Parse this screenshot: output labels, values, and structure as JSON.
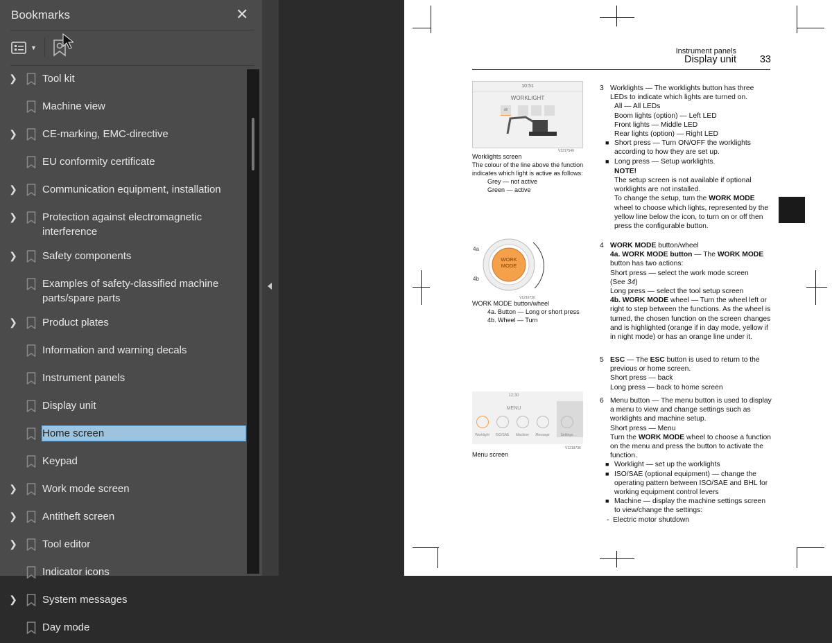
{
  "sidebar": {
    "title": "Bookmarks",
    "close_icon": "close-icon",
    "items": [
      {
        "label": "Tool kit",
        "expandable": true
      },
      {
        "label": "Machine view",
        "expandable": false
      },
      {
        "label": "CE-marking, EMC-directive",
        "expandable": true
      },
      {
        "label": "EU conformity certificate",
        "expandable": false
      },
      {
        "label": "Communication equipment, installation",
        "expandable": true
      },
      {
        "label": "Protection against electromagnetic interference",
        "expandable": true
      },
      {
        "label": "Safety components",
        "expandable": true
      },
      {
        "label": "Examples of safety-classified machine parts/spare parts",
        "expandable": false
      },
      {
        "label": "Product plates",
        "expandable": true
      },
      {
        "label": "Information and warning decals",
        "expandable": false
      },
      {
        "label": "Instrument panels",
        "expandable": false
      },
      {
        "label": "Display unit",
        "expandable": false
      },
      {
        "label": "Home screen",
        "expandable": false,
        "selected": true
      },
      {
        "label": "Keypad",
        "expandable": false
      },
      {
        "label": "Work mode screen",
        "expandable": true
      },
      {
        "label": "Antitheft screen",
        "expandable": true
      },
      {
        "label": "Tool editor",
        "expandable": true
      },
      {
        "label": "Indicator icons",
        "expandable": false
      },
      {
        "label": "System messages",
        "expandable": true
      },
      {
        "label": "Day mode",
        "expandable": false
      }
    ]
  },
  "page": {
    "section": "Instrument panels",
    "title": "Display unit",
    "number": "33",
    "fig1": {
      "screen_time": "10:51",
      "screen_title": "WORKLIGHT",
      "screen_btn": "All",
      "code": "V1217549",
      "caption": "Worklights screen",
      "desc": "The colour of the line above the function indicates which light is active as follows:",
      "lines": [
        "Grey — not active",
        "Green — active"
      ]
    },
    "fig2": {
      "label_a": "4a",
      "label_b": "4b",
      "knob": "WORK MODE",
      "code": "V1216736",
      "caption": "WORK MODE button/wheel",
      "lines": [
        "4a. Button — Long or short press",
        "4b. Wheel — Turn"
      ]
    },
    "fig3": {
      "screen_time": "12:30",
      "screen_title": "MENU",
      "menu": [
        "Worklight",
        "ISO/SAE",
        "Machine",
        "Message",
        "Settings"
      ],
      "code": "V1219736",
      "caption": "Menu screen"
    },
    "item3": {
      "num": "3",
      "intro": "Worklights — The worklights button has three LEDs to indicate which lights are turned on.",
      "sub": [
        "All — All LEDs",
        "Boom lights (option) — Left LED",
        "Front lights — Middle LED",
        "Rear lights (option) — Right LED"
      ],
      "bullets": [
        "Short press — Turn ON/OFF the worklights according to how they are set up.",
        "Long press — Setup worklights."
      ],
      "note_title": "NOTE!",
      "note1": "The setup screen is not available if optional worklights are not installed.",
      "note2a": "To change the setup, turn the ",
      "note2b": "WORK MODE",
      "note2c": " wheel to choose which lights, represented by the yellow line below the icon, to turn on or off then press the configurable button."
    },
    "item4": {
      "num": "4",
      "l1a": "WORK MODE",
      "l1b": " button/wheel",
      "l2a": "4a. WORK MODE button",
      "l2b": " — The ",
      "l2c": "WORK MODE",
      "l2d": " button has two actions:",
      "l3": "Short press — select the work mode screen",
      "l4a": "(See ",
      "l4b": "34",
      "l4c": ")",
      "l5": "Long press — select the tool setup screen",
      "l6a": "4b. WORK MODE",
      "l6b": " wheel — Turn the wheel left or right to step between the functions. As the wheel is turned, the chosen function on the screen changes and is highlighted (orange if in day mode, yellow if in night mode) or has an orange line under it."
    },
    "item5": {
      "num": "5",
      "l1a": "ESC",
      "l1b": " — The ",
      "l1c": "ESC",
      "l1d": " button is used to return to the previous or home screen.",
      "l2": "Short press — back",
      "l3": "Long press — back to home screen"
    },
    "item6": {
      "num": "6",
      "l1": "Menu button — The menu button is used to display a menu to view and change settings such as worklights and machine setup.",
      "l2": "Short press — Menu",
      "l3a": "Turn the ",
      "l3b": "WORK MODE",
      "l3c": " wheel to choose a function on the menu and press the button to activate the function.",
      "bullets": [
        "Worklight — set up the worklights",
        "ISO/SAE (optional equipment) — change the operating pattern between ISO/SAE and BHL for working equipment control levers",
        "Machine — display the machine settings screen to view/change the settings:"
      ],
      "dash": "Electric motor shutdown"
    }
  },
  "colors": {
    "sidebar_bg": "#4b4b4b",
    "selection": "#9ec3de",
    "knob": "#f5a04a"
  }
}
